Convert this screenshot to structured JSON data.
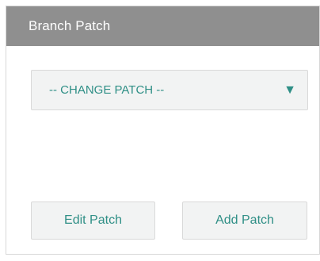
{
  "panel": {
    "title": "Branch Patch",
    "select": {
      "selected_label": "-- CHANGE PATCH --",
      "arrow_icon": "triangle-down-icon",
      "arrow_glyph": "▼"
    },
    "buttons": {
      "edit_label": "Edit Patch",
      "add_label": "Add Patch"
    }
  },
  "colors": {
    "header_bg": "#8f8f8f",
    "accent_text": "#2f8f86",
    "control_bg": "#f2f3f3",
    "border": "#d9d9d9"
  }
}
